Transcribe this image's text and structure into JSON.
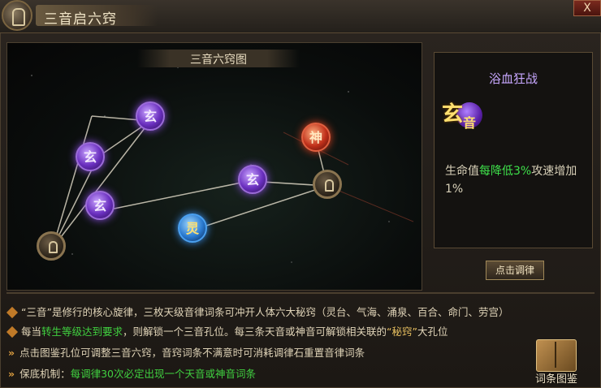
{
  "window": {
    "title": "三音启六窍",
    "close_symbol": "X"
  },
  "map": {
    "title": "三音六窍图",
    "nodes": [
      {
        "id": "xuan-top",
        "glyph": "玄",
        "kind": "xuan"
      },
      {
        "id": "xuan-left",
        "glyph": "玄",
        "kind": "xuan"
      },
      {
        "id": "xuan-mid",
        "glyph": "玄",
        "kind": "xuan"
      },
      {
        "id": "xuan-center",
        "glyph": "玄",
        "kind": "xuan"
      },
      {
        "id": "shen",
        "glyph": "神",
        "kind": "shen"
      },
      {
        "id": "ling",
        "glyph": "灵",
        "kind": "ling"
      },
      {
        "id": "lock-left",
        "glyph": "",
        "kind": "lock"
      },
      {
        "id": "lock-right",
        "glyph": "",
        "kind": "lock"
      }
    ]
  },
  "detail": {
    "name": "浴血狂战",
    "icon_glyph": "玄",
    "icon_sub": "音",
    "desc_pre": "生命值",
    "desc_highlight": "每降低3%",
    "desc_post": "攻速增加1%"
  },
  "buttons": {
    "tune": "点击调律",
    "codex": "词条图鉴"
  },
  "info": {
    "line1": "“三音”是修行的核心旋律，三枚天级音律词条可冲开人体六大秘窍（灵台、气海、涌泉、百合、命门、劳宫）",
    "line2_pre": "每当",
    "line2_hl": "转生等级达到要求",
    "line2_mid": "，则解锁一个三音孔位。每三条天音或神音可解锁相关联的",
    "line2_gold": "“秘窍”",
    "line2_post": "大孔位",
    "line3": "点击图鉴孔位可调整三音六窍，音窍词条不满意时可消耗调律石重置音律词条",
    "line4_pre": "保底机制：",
    "line4_text": "每调律30次必定出现一个天音或神音词条"
  }
}
